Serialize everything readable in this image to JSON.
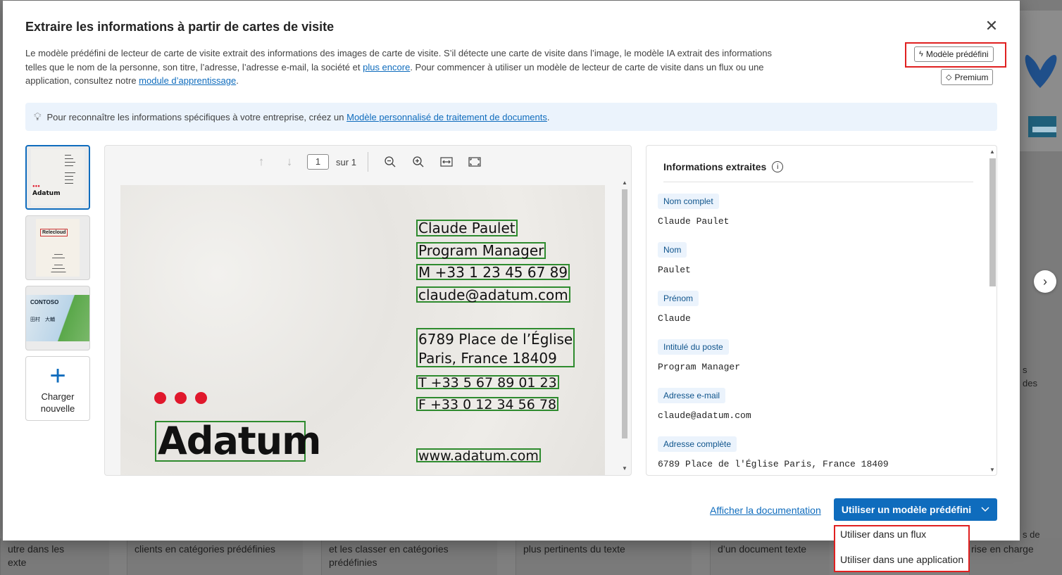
{
  "dialog": {
    "title": "Extraire les informations à partir de cartes de visite",
    "close_glyph": "✕",
    "description": {
      "part1": "Le modèle prédéfini de lecteur de carte de visite extrait des informations des images de carte de visite. S’il détecte une carte de visite dans l’image, le modèle IA extrait des informations telles que le nom de la personne, son titre, l’adresse, l’adresse e-mail, la société et ",
      "link1": "plus encore",
      "part2": ". Pour commencer à utiliser un modèle de lecteur de carte de visite dans un flux ou une application, consultez notre ",
      "link2": "module d’apprentissage",
      "part3": "."
    },
    "badge_prebuilt": "Modèle prédéfini",
    "badge_premium": "Premium",
    "info_bar": {
      "text": "Pour reconnaître les informations spécifiques à votre entreprise, créez un ",
      "link": "Modèle personnalisé de traitement de documents",
      "suffix": "."
    }
  },
  "thumbnails": {
    "upload_label_1": "Charger",
    "upload_label_2": "nouvelle",
    "thumb1_brand": "Adatum",
    "thumb2_brand": "Relecloud",
    "thumb3_brand": "CONTOSO",
    "thumb3_name": "田村　大輔"
  },
  "viewer": {
    "page_value": "1",
    "page_of": "sur 1",
    "card": {
      "name": "Claude Paulet",
      "title": "Program Manager",
      "mobile": "M +33 1 23 45 67 89",
      "email": "claude@adatum.com",
      "address_1": "6789 Place de l’Église",
      "address_2": "Paris, France 18409",
      "phone": "T +33 5 67 89 01 23",
      "fax": "F +33 0 12 34 56 78",
      "website": "www.adatum.com",
      "logo": "Adatum"
    }
  },
  "extracted": {
    "title": "Informations extraites",
    "fields": [
      {
        "label": "Nom complet",
        "value": "Claude Paulet"
      },
      {
        "label": "Nom",
        "value": "Paulet"
      },
      {
        "label": "Prénom",
        "value": "Claude"
      },
      {
        "label": "Intitulé du poste",
        "value": "Program Manager"
      },
      {
        "label": "Adresse e-mail",
        "value": "claude@adatum.com"
      },
      {
        "label": "Adresse complète",
        "value": "6789 Place de l'Église Paris, France 18409"
      }
    ]
  },
  "footer": {
    "doc_link": "Afficher la documentation",
    "primary_button": "Utiliser un modèle prédéfini",
    "dropdown": [
      "Utiliser dans un flux",
      "Utiliser dans une application"
    ]
  },
  "background": {
    "cards": [
      {
        "line1": "utre dans les",
        "line2": "exte"
      },
      {
        "line1": "clients en catégories prédéfinies",
        "line2": ""
      },
      {
        "line1": "et les classer en catégories",
        "line2": "prédéfinies"
      },
      {
        "line1": "plus pertinents du texte",
        "line2": ""
      },
      {
        "line1": "d’un document texte",
        "line2": ""
      },
      {
        "line1": "rise en charge",
        "line2": ""
      }
    ],
    "right_snippets": [
      "s",
      "des",
      "s de"
    ]
  },
  "colors": {
    "accent": "#0f6cbd",
    "highlight_red": "#e02020",
    "field_box_green": "#2e8b2e"
  }
}
